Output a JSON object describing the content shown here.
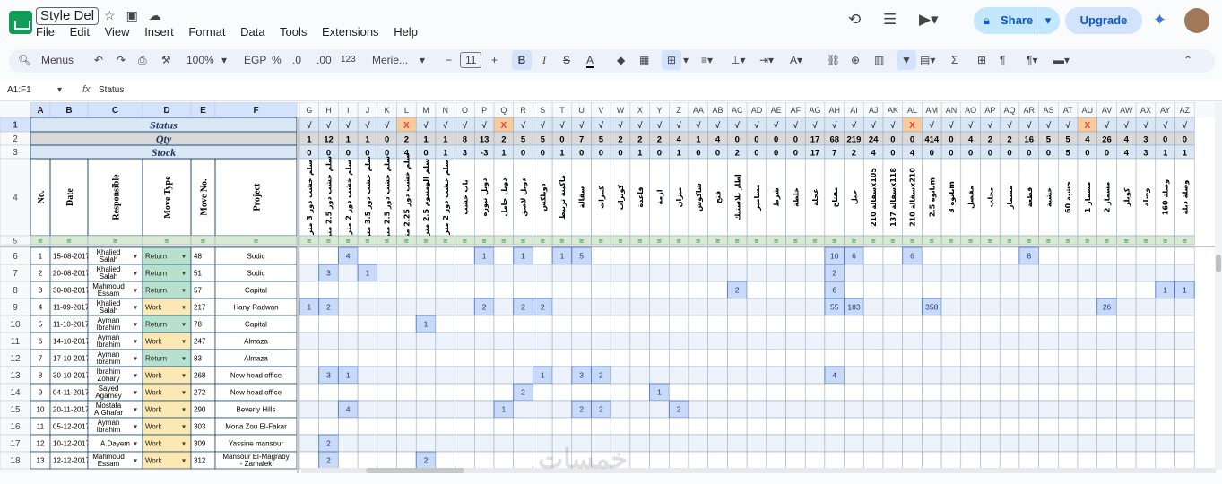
{
  "app": {
    "doc_title": "Style Del",
    "menu": [
      "File",
      "Edit",
      "View",
      "Insert",
      "Format",
      "Data",
      "Tools",
      "Extensions",
      "Help"
    ],
    "share_label": "Share",
    "upgrade_label": "Upgrade"
  },
  "toolbar": {
    "menus_label": "Menus",
    "zoom": "100%",
    "currency": "EGP",
    "percent": "%",
    "dec_minus": ".0",
    "dec_plus": ".00",
    "num_format": "123",
    "font": "Merie...",
    "font_size": "11"
  },
  "formula_bar": {
    "name_box": "A1:F1",
    "fx": "fx",
    "formula": "Status"
  },
  "grid": {
    "left_cols": [
      "A",
      "B",
      "C",
      "D",
      "E",
      "F"
    ],
    "right_cols": [
      "G",
      "H",
      "I",
      "J",
      "K",
      "L",
      "M",
      "N",
      "O",
      "P",
      "Q",
      "R",
      "S",
      "T",
      "U",
      "V",
      "W",
      "X",
      "Y",
      "Z",
      "AA",
      "AB",
      "AC",
      "AD",
      "AE",
      "AF",
      "AG",
      "AH",
      "AI",
      "AJ",
      "AK",
      "AL",
      "AM",
      "AN",
      "AO",
      "AP",
      "AQ",
      "AR",
      "AS",
      "AT",
      "AU",
      "AV",
      "AW",
      "AX",
      "AY",
      "AZ"
    ],
    "labels": {
      "status": "Status",
      "qty": "Qty",
      "stock": "Stock"
    },
    "headers": [
      "No.",
      "Date",
      "Responsible",
      "Move Type",
      "Move No.",
      "Project"
    ],
    "status_row": [
      "√",
      "√",
      "√",
      "√",
      "√",
      "X",
      "√",
      "√",
      "√",
      "√",
      "X",
      "√",
      "√",
      "√",
      "√",
      "√",
      "√",
      "√",
      "√",
      "√",
      "√",
      "√",
      "√",
      "√",
      "√",
      "√",
      "√",
      "√",
      "√",
      "√",
      "√",
      "X",
      "√",
      "√",
      "√",
      "√",
      "√",
      "√",
      "√",
      "√",
      "X",
      "√",
      "√",
      "√",
      "√",
      "√"
    ],
    "qty_row": [
      "1",
      "12",
      "1",
      "1",
      "0",
      "2",
      "1",
      "1",
      "8",
      "13",
      "2",
      "5",
      "5",
      "0",
      "7",
      "5",
      "2",
      "2",
      "2",
      "4",
      "1",
      "4",
      "0",
      "0",
      "0",
      "0",
      "17",
      "68",
      "219",
      "24",
      "0",
      "0",
      "414",
      "0",
      "4",
      "2",
      "2",
      "16",
      "5",
      "5",
      "4",
      "26",
      "4",
      "3",
      "0",
      "0"
    ],
    "stock_row": [
      "0",
      "0",
      "0",
      "0",
      "0",
      "4",
      "0",
      "1",
      "3",
      "-3",
      "1",
      "0",
      "0",
      "1",
      "0",
      "0",
      "0",
      "1",
      "0",
      "1",
      "0",
      "0",
      "2",
      "0",
      "0",
      "0",
      "17",
      "7",
      "2",
      "4",
      "0",
      "4",
      "0",
      "0",
      "0",
      "0",
      "0",
      "0",
      "0",
      "5",
      "0",
      "0",
      "4",
      "3",
      "1",
      "1"
    ],
    "item_names": [
      "سلم خشب دور 3 متر",
      "سلم خشب دور 2.5 متر",
      "سلم خشب دور 2 متر",
      "سلم خشب دور 3.5 متر",
      "سلم خشب دور 2.5 متر",
      "سلم خشب دور 2.25 متر",
      "سلم الومنيوم 2.5 متر",
      "سلم خشب دور 2 متر",
      "باب خشب",
      "دوبل نيوزه",
      "دوبل حامل",
      "دوبل لاصق",
      "دوبلكس",
      "ماكينة تربيط",
      "سقالة",
      "كمرات",
      "كوبرات",
      "قاعدة",
      "ازمة",
      "ميزان",
      "شاكوش",
      "فتح",
      "إطار بلاستيك",
      "مسامير",
      "شرط",
      "خلطة",
      "عجلة",
      "مفتاح",
      "حبل",
      "سقالة 210x105",
      "سقالة 137x118",
      "سقالة 210x210",
      "بانوه 2.5m",
      "بانوه 3m",
      "مفصل",
      "مخلب",
      "مسمار",
      "قطعة",
      "خشبة",
      "خشبة 60",
      "مسمار 1",
      "مسمار 2",
      "كوبلر",
      "وصلة",
      "وصلة 160",
      "وصلة دبلة"
    ],
    "rows": [
      {
        "row": "6",
        "no": "1",
        "date": "15-08-2017",
        "resp": "Khalied Salah",
        "type": "Return",
        "move": "48",
        "project": "Sodic",
        "cells": {
          "I": "4",
          "P": "1",
          "R": "1",
          "T": "1",
          "U": "5",
          "AH": "10",
          "AI": "6",
          "AL": "6",
          "AR": "8"
        }
      },
      {
        "row": "7",
        "no": "2",
        "date": "20-08-2017",
        "resp": "Khalied Salah",
        "type": "Return",
        "move": "51",
        "project": "Sodic",
        "cells": {
          "H": "3",
          "J": "1",
          "AH": "2"
        }
      },
      {
        "row": "8",
        "no": "3",
        "date": "30-08-2017",
        "resp": "Mahmoud Essam",
        "type": "Return",
        "move": "57",
        "project": "Capital",
        "cells": {
          "AC": "2",
          "AH": "6",
          "AY": "1",
          "AZ": "1"
        }
      },
      {
        "row": "9",
        "no": "4",
        "date": "11-09-2017",
        "resp": "Khalied Salah",
        "type": "Work",
        "move": "217",
        "project": "Hany Radwan",
        "cells": {
          "G": "1",
          "H": "2",
          "P": "2",
          "R": "2",
          "S": "2",
          "AH": "55",
          "AI": "183",
          "AM": "358",
          "AV": "26"
        }
      },
      {
        "row": "10",
        "no": "5",
        "date": "11-10-2017",
        "resp": "Ayman Ibrahim",
        "type": "Return",
        "move": "78",
        "project": "Capital",
        "cells": {
          "M": "1"
        }
      },
      {
        "row": "11",
        "no": "6",
        "date": "14-10-2017",
        "resp": "Ayman Ibrahim",
        "type": "Work",
        "move": "247",
        "project": "Almaza",
        "cells": {}
      },
      {
        "row": "12",
        "no": "7",
        "date": "17-10-2017",
        "resp": "Ayman Ibrahim",
        "type": "Return",
        "move": "83",
        "project": "Almaza",
        "cells": {}
      },
      {
        "row": "13",
        "no": "8",
        "date": "30-10-2017",
        "resp": "Ibrahim Zohary",
        "type": "Work",
        "move": "268",
        "project": "New head office",
        "cells": {
          "H": "3",
          "I": "1",
          "S": "1",
          "U": "3",
          "V": "2",
          "AH": "4"
        }
      },
      {
        "row": "14",
        "no": "9",
        "date": "04-11-2017",
        "resp": "Sayed Agamey",
        "type": "Work",
        "move": "272",
        "project": "New head office",
        "cells": {
          "R": "2",
          "Y": "1"
        }
      },
      {
        "row": "15",
        "no": "10",
        "date": "20-11-2017",
        "resp": "Mostafa A.Ghafar",
        "type": "Work",
        "move": "290",
        "project": "Beverly Hills",
        "cells": {
          "I": "4",
          "Q": "1",
          "U": "2",
          "V": "2",
          "Z": "2"
        }
      },
      {
        "row": "16",
        "no": "11",
        "date": "05-12-2017",
        "resp": "Ayman Ibrahim",
        "type": "Work",
        "move": "303",
        "project": "Mona Zou El-Fakar",
        "cells": {}
      },
      {
        "row": "17",
        "no": "12",
        "date": "10-12-2017",
        "resp": "A.Dayem",
        "type": "Work",
        "move": "309",
        "project": "Yassine mansour",
        "cells": {
          "H": "2"
        }
      },
      {
        "row": "18",
        "no": "13",
        "date": "12-12-2017",
        "resp": "Mahmoud Essam",
        "type": "Work",
        "move": "312",
        "project": "Mansour El-Magraby - Zamalek",
        "cells": {
          "H": "2",
          "M": "2"
        }
      }
    ]
  },
  "colors": {
    "header_gray": "#f8f9fa",
    "selected_col_header": "#d3e3fd",
    "label_band": "#d9e7f5",
    "qty_band": "#d9d9d9",
    "return_green": "#b7e1cd",
    "work_yellow": "#fce8b2",
    "blue_cell": "#c9daf8",
    "x_red": "#ea4335",
    "x_bg": "#f9cb9c",
    "border_dark": "#1f4e79"
  }
}
